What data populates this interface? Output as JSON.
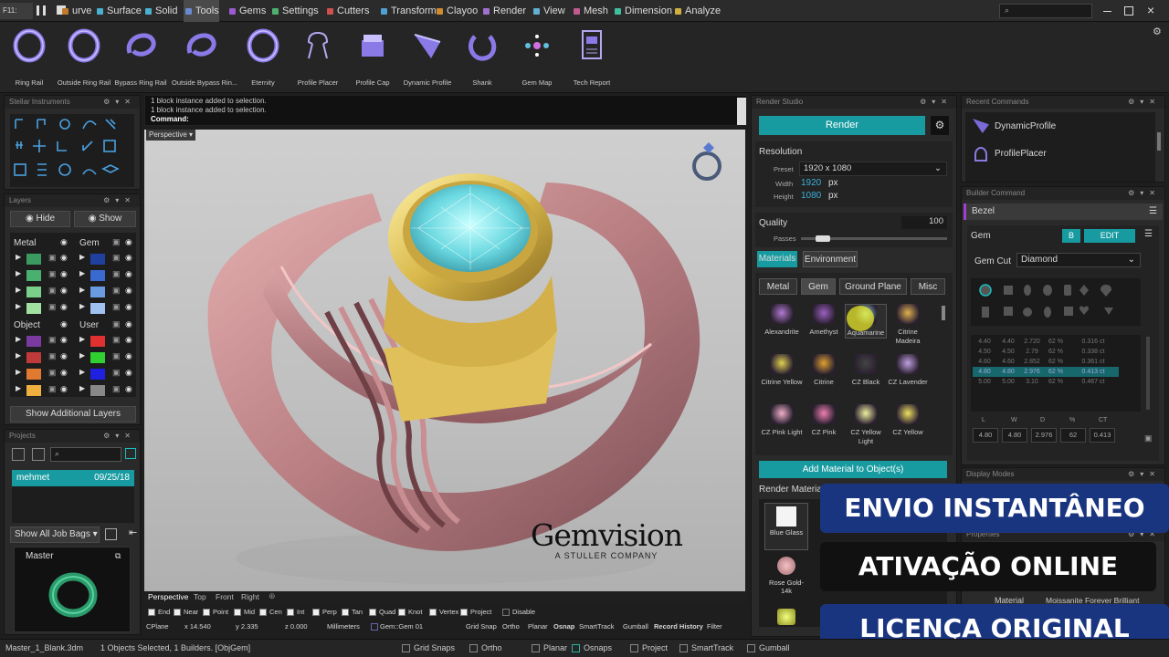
{
  "menubar": {
    "stop": "F11: Stop",
    "items": [
      "urve",
      "Surface",
      "Solid",
      "Tools",
      "Gems",
      "Settings",
      "Cutters",
      "Transform",
      "Clayoo",
      "Render",
      "View",
      "Mesh",
      "Dimension",
      "Analyze"
    ],
    "colors": [
      "#c07a2a",
      "#4ab0d0",
      "#4ab0d0",
      "#6a8ad0",
      "#9a5ad0",
      "#50b070",
      "#d05050",
      "#50a0d0",
      "#d08a30",
      "#a070d0",
      "#60b0d0",
      "#c05a90",
      "#40c0a0",
      "#d0b040"
    ]
  },
  "toolbar": {
    "tools": [
      "Ring Rail",
      "Outside Ring Rail",
      "Bypass Ring Rail",
      "Outside Bypass Rin...",
      "Eternity",
      "Profile Placer",
      "Profile Cap",
      "Dynamic Profile",
      "Shank",
      "Gem Map",
      "Tech Report"
    ]
  },
  "left": {
    "tools_title": "Stellar Instruments",
    "layers_title": "Layers",
    "hide": "Hide",
    "show": "Show",
    "metal": "Metal",
    "gem": "Gem",
    "object": "Object",
    "user": "User",
    "show_additional": "Show Additional Layers",
    "projects_title": "Projects",
    "project_name": "mehmet",
    "project_date": "09/25/18",
    "job_bags": "Show All Job Bags",
    "master": "Master"
  },
  "command": {
    "line1": "1 block instance added to selection.",
    "line2": "1 block instance added to selection.",
    "prompt": "Command:"
  },
  "viewport": {
    "label": "Perspective",
    "brand": "Gemvision",
    "brand_sub": "A STULLER COMPANY",
    "tabs": [
      "Perspective",
      "Top",
      "Front",
      "Right"
    ]
  },
  "osnaps": [
    "End",
    "Near",
    "Point",
    "Mid",
    "Cen",
    "Int",
    "Perp",
    "Tan",
    "Quad",
    "Knot",
    "Vertex",
    "Project",
    "Disable"
  ],
  "coords": {
    "cplane": "CPlane",
    "x": "x 14.540",
    "y": "y 2.335",
    "z": "z 0.000",
    "units": "Millimeters",
    "layer": "Gem::Gem 01",
    "items": [
      "Grid Snap",
      "Ortho",
      "Planar",
      "Osnap",
      "SmartTrack",
      "Gumball",
      "Record History",
      "Filter"
    ]
  },
  "render": {
    "title": "Render Studio",
    "button": "Render",
    "resolution": "Resolution",
    "preset_label": "Preset",
    "preset": "1920 x 1080",
    "width_label": "Width",
    "width": "1920",
    "height_label": "Height",
    "height": "1080",
    "px": "px",
    "quality": "Quality",
    "quality_val": "100",
    "passes": "Passes",
    "passes_level": 0.15,
    "tab_materials": "Materials",
    "tab_environment": "Environment",
    "subtabs": [
      "Metal",
      "Gem",
      "Ground Plane",
      "Misc"
    ],
    "gems": [
      "Alexandrite",
      "Amethyst",
      "Aquamarine",
      "Citrine Madeira",
      "Citrine Yellow",
      "Citrine",
      "CZ Black",
      "CZ Lavender",
      "CZ Pink Light",
      "CZ Pink",
      "CZ Yellow Light",
      "CZ Yellow"
    ],
    "add_material": "Add Material to Object(s)",
    "render_materials": "Render Materials",
    "rm_items": [
      "Blue Glass",
      "Rose Gold-14k"
    ]
  },
  "right": {
    "recent_title": "Recent Commands",
    "recent": [
      "DynamicProfile",
      "ProfilePlacer"
    ],
    "bezel_title": "Builder Command",
    "bezel": "Bezel",
    "gem": "Gem",
    "b": "B",
    "edit": "EDIT",
    "gem_cut_label": "Gem Cut",
    "gem_cut": "Diamond",
    "table": [
      [
        "4.40",
        "4.40",
        "2.720",
        "62 %",
        "0.316 ct"
      ],
      [
        "4.50",
        "4.50",
        "2.79",
        "62 %",
        "0.338 ct"
      ],
      [
        "4.60",
        "4.60",
        "2.852",
        "62 %",
        "0.361 ct"
      ],
      [
        "4.80",
        "4.80",
        "2.976",
        "62 %",
        "0.413 ct"
      ],
      [
        "5.00",
        "5.00",
        "3.10",
        "62 %",
        "0.467 ct"
      ]
    ],
    "cols": [
      "L",
      "W",
      "D",
      "%",
      "CT"
    ],
    "values": [
      "4.80",
      "4.80",
      "2.976",
      "62",
      "0.413"
    ],
    "display_title": "Display Modes",
    "props_title": "Properties",
    "material_label": "Material",
    "material": "Moissanite Forever Brilliant"
  },
  "promo": [
    "ENVIO INSTANTÂNEO",
    "ATIVAÇÃO ONLINE",
    "LICENÇA ORIGINAL"
  ],
  "status": {
    "file": "Master_1_Blank.3dm",
    "selected": "1 Objects Selected, 1 Builders. [ObjGem]",
    "items": [
      "Grid Snaps",
      "Ortho",
      "Planar",
      "Osnaps",
      "Project",
      "SmartTrack",
      "Gumball"
    ]
  }
}
